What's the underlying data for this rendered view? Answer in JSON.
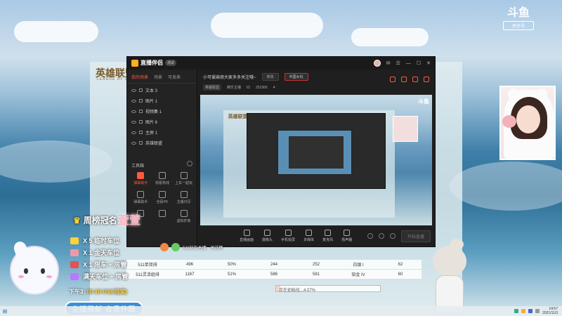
{
  "background": {
    "lol_logo": "英雄联盟",
    "lol_logo_sub": "LEAGUE OF LEGENDS"
  },
  "douyu": {
    "logo": "斗鱼",
    "sub": "虎牙号"
  },
  "window": {
    "app_name": "直播伴侣",
    "version": "测试",
    "left_tabs": [
      "我的场景",
      "场景",
      "可发表"
    ],
    "scenes": [
      "文本 3",
      "图片 1",
      "视频集 1",
      "图片 6",
      "主屏 1",
      "英雄联盟"
    ],
    "tools_label": "工具箱",
    "tools": [
      "弹幕助手",
      "观看热线",
      "上车一起玩",
      "弹幕助手",
      "全民PK",
      "主播日历",
      "",
      "",
      "虚拟形象"
    ],
    "room_title": "小可爱麻烦大家多多关注哦~",
    "room_title_pill1": "修改",
    "room_title_pill2": "中国女玩",
    "room_meta_tag": "英雄联盟",
    "room_meta_sub": "娱乐主播",
    "room_meta_id": "ID",
    "room_meta_viewers": "252366",
    "room_meta_likes": "4",
    "info_icons": [
      "",
      "",
      "",
      ""
    ],
    "bottom_items": [
      "直播画面",
      "摄像头",
      "手机投屏",
      "多媒体",
      "麦克风",
      "扬声器"
    ],
    "start_button": "开始直播"
  },
  "overlay": {
    "rank_title": "周榜冠名:",
    "rank_name": "萱萱",
    "perks": [
      "X 5 临时车位",
      "X 1 金天车位",
      "X 1 限车 + 房管",
      "满天车位 + 房管"
    ],
    "time_prefix": "下午3:",
    "time_value": "00:10:00(6倍奖)",
    "tagline": "主播萌新 自我扑腾",
    "chat_text": "511钻石主播:",
    "chat_sub": "关注榜"
  },
  "stats": {
    "rows": [
      [
        "511单双排",
        "496",
        "50%",
        "244",
        "252",
        "白银 I",
        "62"
      ],
      [
        "511灵活组排",
        "1167",
        "51%",
        "586",
        "581",
        "铂金 IV",
        "60"
      ]
    ]
  },
  "progress": {
    "text": "正在初始化...4.07%",
    "value": 4.07
  },
  "taskbar": {
    "time": "14:57",
    "date": "2021/11/3"
  },
  "colors": {
    "accent": "#ff5a3c",
    "window_bg": "#1f1f1f"
  }
}
